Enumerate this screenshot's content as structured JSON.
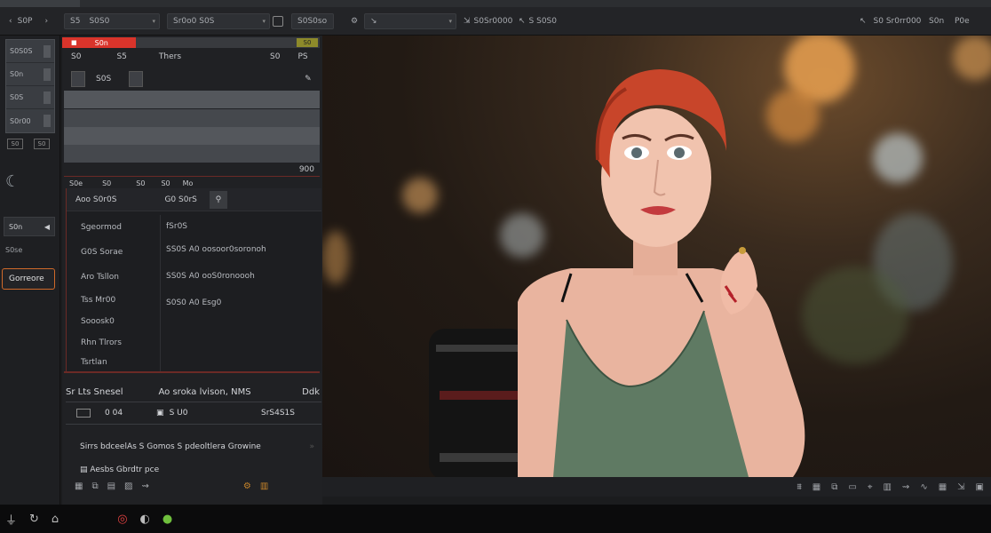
{
  "toolbar": {
    "back_label": "S0P",
    "field1": "S5",
    "field2": "S0S0",
    "field3": "Sr0o0 S0S",
    "field4": "S0S0so",
    "field5_label": "S0Sr0000",
    "field6_label": "S S0S0",
    "right": [
      "S0 Sr0rr000",
      "S0n",
      "P0e"
    ]
  },
  "rail": {
    "items": [
      "S0S0S",
      "S0n",
      "S0S",
      "S0r00"
    ],
    "small_buttons": [
      "S0",
      "S0"
    ],
    "btn_row_label": "S0n",
    "label": "S0se",
    "active_button": "Gorreore"
  },
  "panel": {
    "red_tab": "S0n",
    "yellow_tab": "S0",
    "header": {
      "left": "S0",
      "left2": "S5",
      "middle": "Thers",
      "right1": "S0",
      "right2": "PS"
    },
    "row1": {
      "label": "S0S"
    },
    "count": "900",
    "detail_head": [
      "S0e",
      "S0",
      "S0",
      "S0",
      "Mo"
    ],
    "detail_title_left": "Aoo S0r0S",
    "detail_title_right": "G0 S0rS",
    "col1": [
      "Sgeormod",
      "G0S Sorae",
      "Aro Tsllon",
      "Tss Mr00",
      "Sooosk0",
      "Rhn Tlrors",
      "Tsrtlan"
    ],
    "col2": [
      "fSr0S",
      "SS0S A0 oosoor0soronoh",
      "SS0S A0 ooS0ronoooh",
      "S0S0 A0 Esg0"
    ],
    "bottom_title_left": "Sr Lts Snesel",
    "bottom_title_mid": "Ao sroka lvison, NMS",
    "bottom_title_right": "Ddk",
    "bottom_row": {
      "a": "0 04",
      "b": "S U0",
      "c": "SrS4S1S"
    },
    "description": "Sirrs bdceelAs S Gomos S pdeoltlera Growine",
    "note": "Aesbs Gbrdtr pce"
  },
  "status_icons": [
    "mid",
    "S0",
    "S0",
    "S0",
    "S0",
    "S0",
    "S0",
    "S0",
    "S0",
    "S0",
    "S0"
  ],
  "taskbar": [
    "app1",
    "app2",
    "app3",
    "app4",
    "app5",
    "app6"
  ]
}
